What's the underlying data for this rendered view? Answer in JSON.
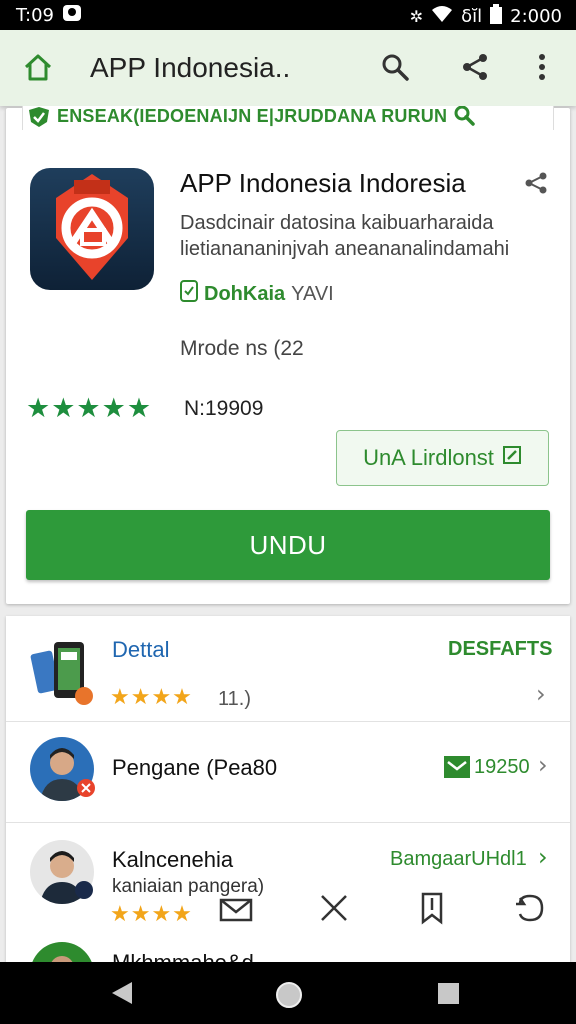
{
  "status_bar": {
    "time": "T:09",
    "network_label": "δĭl",
    "clock": "2:000"
  },
  "app_bar": {
    "title": "APP  Indonesia..",
    "icons": [
      "home-icon",
      "search-icon",
      "share-icon",
      "more-vert-icon"
    ]
  },
  "search_strip": {
    "text": "ENSEAK(IEDOENAIJN  E|JRUDDANA RURUN"
  },
  "app": {
    "name": "APP Indonesia Indoresia",
    "description_line1": "Dasdcinair datosina kaibuarharaida",
    "description_line2": "lietianananinjvah aneananalindamahi",
    "developer_name": "DohKaia",
    "developer_suffix": "YAVI",
    "version": "Mrode ns (22",
    "rating_stars": "★★★★★",
    "downloads": "N:19909",
    "secondary_button": "UnA Lirdlonst",
    "primary_button": "UNDU"
  },
  "list": [
    {
      "title": "Dettal",
      "right": "DESFAFTS",
      "stars": "★★★★",
      "rating": "11.)"
    },
    {
      "title": "Pengane (Pea80",
      "right": "19250"
    },
    {
      "title": "Kalncenehia",
      "subtitle": "kaniaian pangera)",
      "right": "BamgaarUHdl1",
      "stars": "★★★★"
    },
    {
      "title": "Mkhmmahe&d"
    }
  ],
  "colors": {
    "accent_green": "#2e9a3a",
    "star_orange": "#f2a51a"
  }
}
